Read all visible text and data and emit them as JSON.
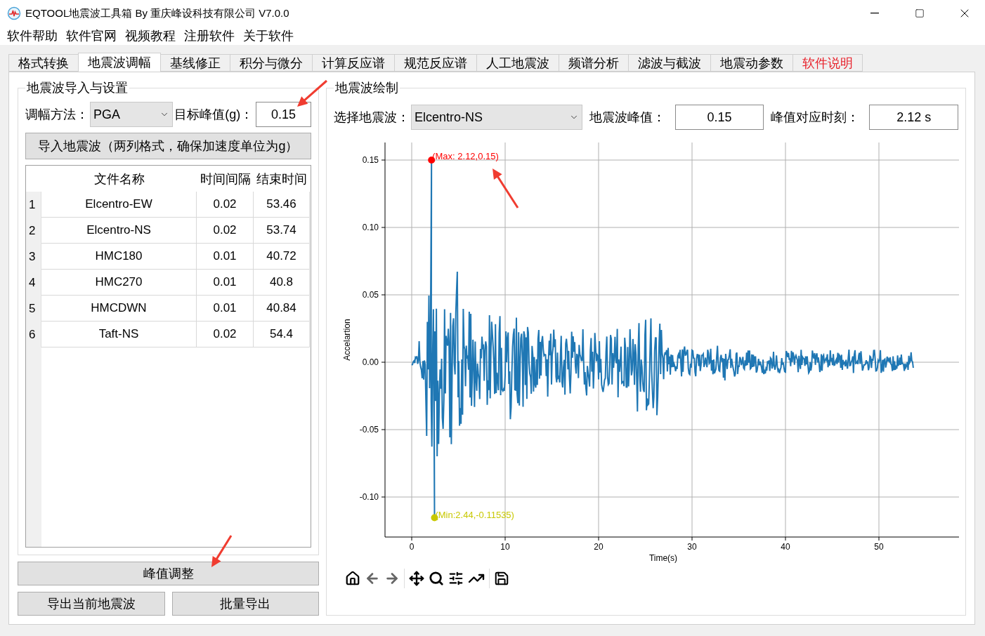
{
  "window": {
    "title": "EQTOOL地震波工具箱 By 重庆峰设科技有限公司  V7.0.0"
  },
  "menu": [
    "软件帮助",
    "软件官网",
    "视频教程",
    "注册软件",
    "关于软件"
  ],
  "tabs": [
    {
      "label": "格式转换",
      "selected": false
    },
    {
      "label": "地震波调幅",
      "selected": true
    },
    {
      "label": "基线修正",
      "selected": false
    },
    {
      "label": "积分与微分",
      "selected": false
    },
    {
      "label": "计算反应谱",
      "selected": false
    },
    {
      "label": "规范反应谱",
      "selected": false
    },
    {
      "label": "人工地震波",
      "selected": false
    },
    {
      "label": "频谱分析",
      "selected": false
    },
    {
      "label": "滤波与截波",
      "selected": false
    },
    {
      "label": "地震动参数",
      "selected": false
    },
    {
      "label": "软件说明",
      "selected": false,
      "color": "#e8202a"
    }
  ],
  "import_panel": {
    "title": "地震波导入与设置",
    "method_label": "调幅方法：",
    "method_value": "PGA",
    "target_label": "目标峰值(g)：",
    "target_value": "0.15",
    "import_button": "导入地震波（两列格式，确保加速度单位为g）",
    "table": {
      "columns": [
        "文件名称",
        "时间间隔",
        "结束时间"
      ],
      "rows": [
        {
          "index": "1",
          "cells": [
            "Elcentro-EW",
            "0.02",
            "53.46"
          ]
        },
        {
          "index": "2",
          "cells": [
            "Elcentro-NS",
            "0.02",
            "53.74"
          ]
        },
        {
          "index": "3",
          "cells": [
            "HMC180",
            "0.01",
            "40.72"
          ]
        },
        {
          "index": "4",
          "cells": [
            "HMC270",
            "0.01",
            "40.8"
          ]
        },
        {
          "index": "5",
          "cells": [
            "HMCDWN",
            "0.01",
            "40.84"
          ]
        },
        {
          "index": "6",
          "cells": [
            "Taft-NS",
            "0.02",
            "54.4"
          ]
        }
      ]
    }
  },
  "buttons": {
    "adjust": "峰值调整",
    "export_current": "导出当前地震波",
    "export_batch": "批量导出"
  },
  "plot_panel": {
    "title": "地震波绘制",
    "select_label": "选择地震波：",
    "select_value": "Elcentro-NS",
    "peak_label": "地震波峰值：",
    "peak_value": "0.15",
    "time_label": "峰值对应时刻：",
    "time_value": "2.12 s",
    "plot": {
      "ylabel": "Accelartion",
      "xlabel": "Time(s)",
      "yticks": [
        "0.15",
        "0.10",
        "0.05",
        "0.00",
        "-0.05",
        "-0.10"
      ],
      "xticks": [
        "0",
        "10",
        "20",
        "30",
        "40",
        "50"
      ],
      "max_label": "(Max: 2.12,0.15)",
      "min_label": "(Min:2.44,-0.11535)"
    }
  }
}
